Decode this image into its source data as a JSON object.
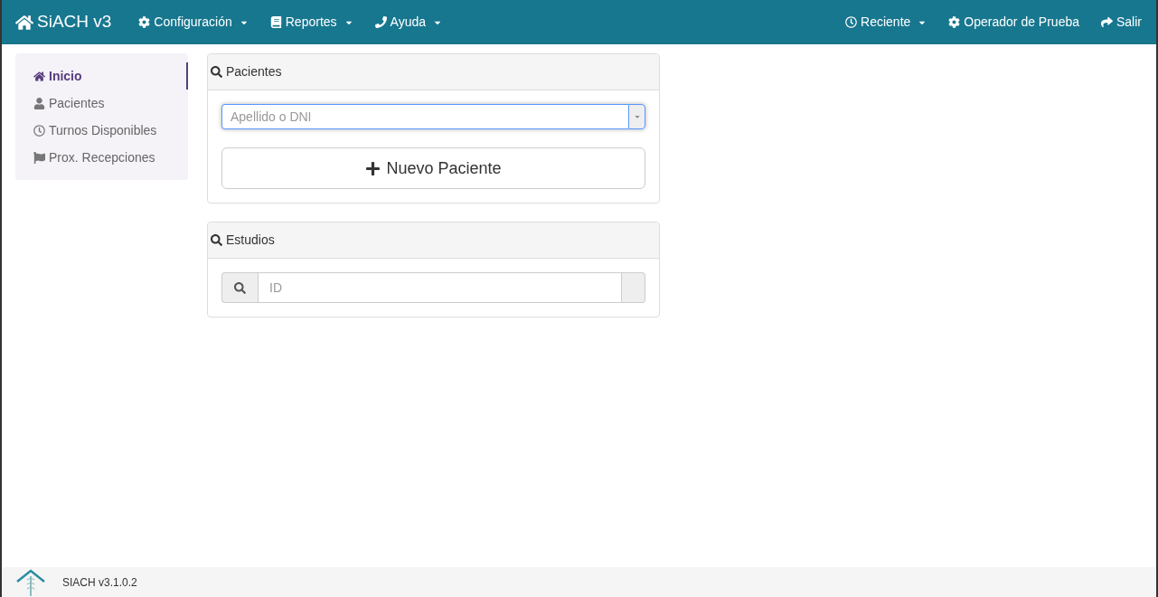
{
  "navbar": {
    "brand": "SiACH v3",
    "menus": [
      {
        "label": "Configuración",
        "kind": "gear",
        "dropdown": true
      },
      {
        "label": "Reportes",
        "kind": "book",
        "dropdown": true
      },
      {
        "label": "Ayuda",
        "kind": "phone",
        "dropdown": true
      }
    ],
    "right_menus": [
      {
        "label": "Reciente",
        "kind": "clock",
        "dropdown": true
      },
      {
        "label": "Operador de Prueba",
        "kind": "gear",
        "dropdown": false
      },
      {
        "label": "Salir",
        "kind": "share",
        "dropdown": false
      }
    ]
  },
  "sidebar": {
    "items": [
      {
        "label": "Inicio",
        "kind": "home",
        "selected": true
      },
      {
        "label": "Pacientes",
        "kind": "user",
        "selected": false
      },
      {
        "label": "Turnos Disponibles",
        "kind": "clock",
        "selected": false
      },
      {
        "label": "Prox. Recepciones",
        "kind": "flag",
        "selected": false
      }
    ]
  },
  "pacientes_panel": {
    "title": "Pacientes",
    "search": {
      "placeholder": "Apellido o DNI"
    },
    "button": "Nuevo Paciente"
  },
  "estudios_panel": {
    "title": "Estudios",
    "search": {
      "placeholder": "ID"
    }
  },
  "footer": {
    "version": "SIACH v3.1.0.2"
  }
}
